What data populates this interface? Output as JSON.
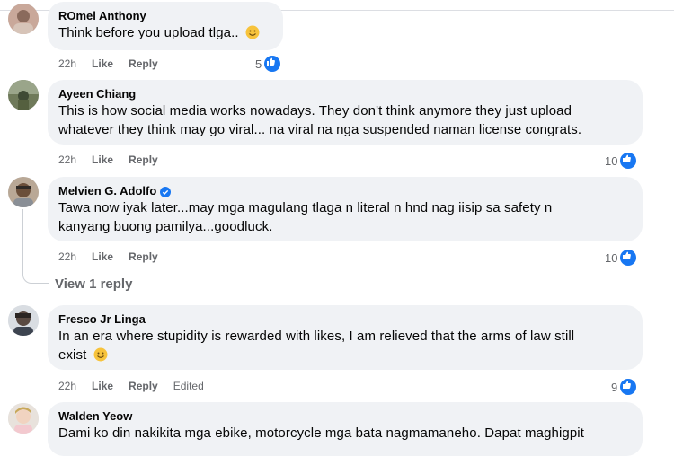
{
  "comments": [
    {
      "author": "ROmel Anthony",
      "text": "Think before you upload tlga..",
      "emoji": "smile-emoji",
      "time": "22h",
      "like": "Like",
      "reply": "Reply",
      "reactions": "5"
    },
    {
      "author": "Ayeen Chiang",
      "text_lines": [
        "This is how social media works nowadays. They don't think anymore they just upload",
        "whatever they think may go viral... na viral na nga suspended naman license congrats."
      ],
      "time": "22h",
      "like": "Like",
      "reply": "Reply",
      "reactions": "10"
    },
    {
      "author": "Melvien G. Adolfo",
      "verified": true,
      "text_lines": [
        "Tawa now iyak later...may mga magulang tlaga n literal n hnd nag iisip sa safety n",
        "kanyang buong pamilya...goodluck."
      ],
      "time": "22h",
      "like": "Like",
      "reply": "Reply",
      "reactions": "10",
      "view_replies": "View 1 reply"
    },
    {
      "author": "Fresco Jr Linga",
      "text_lines": [
        "In an era where stupidity is rewarded with likes, I am relieved that the arms of law still",
        "exist"
      ],
      "emoji": "smile-emoji",
      "time": "22h",
      "like": "Like",
      "reply": "Reply",
      "edited": "Edited",
      "reactions": "9"
    },
    {
      "author": "Walden Yeow",
      "text_lines": [
        "Dami ko din nakikita mga ebike, motorcycle mga bata nagmamaneho. Dapat maghigpit"
      ]
    }
  ],
  "colors": {
    "bubble": "#f0f2f5",
    "meta": "#65676b",
    "like_blue": "#1877f2",
    "text": "#050505"
  }
}
